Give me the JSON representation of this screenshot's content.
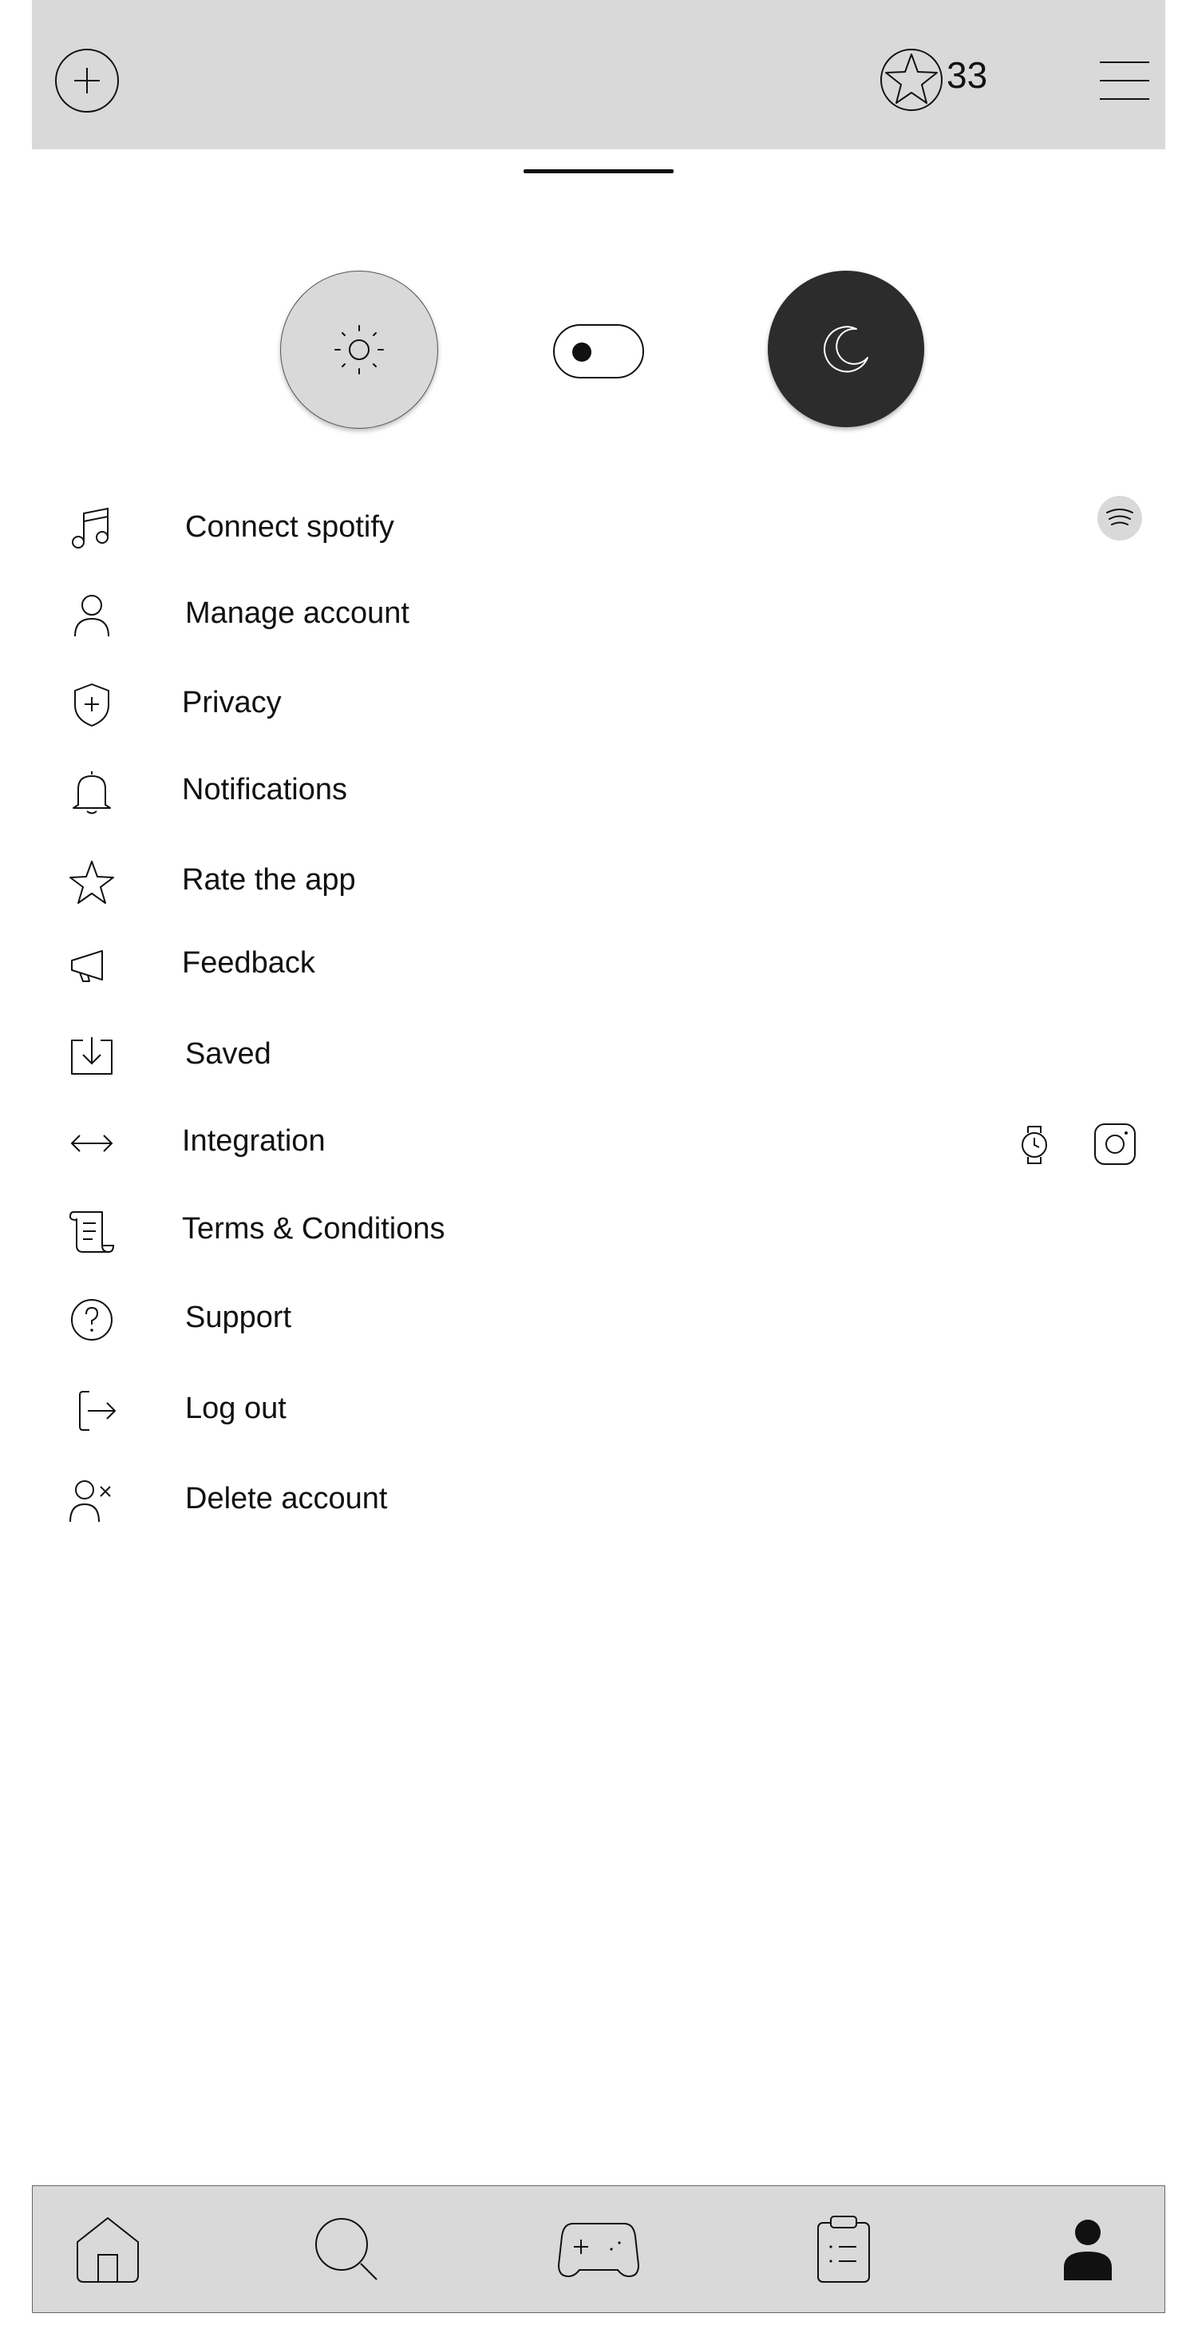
{
  "header": {
    "add_icon": "plus-circle-icon",
    "stars_icon": "star-badge-icon",
    "stars_count": "33",
    "menu_icon": "hamburger-menu-icon"
  },
  "theme": {
    "light_icon": "sun-icon",
    "dark_icon": "moon-icon",
    "toggle_state": "light"
  },
  "settings": {
    "items": [
      {
        "label": "Connect spotify",
        "icon": "music-note-icon",
        "accessory": [
          "spotify-icon"
        ]
      },
      {
        "label": "Manage account",
        "icon": "user-icon"
      },
      {
        "label": "Privacy",
        "icon": "shield-icon"
      },
      {
        "label": "Notifications",
        "icon": "bell-icon"
      },
      {
        "label": "Rate the app",
        "icon": "star-icon"
      },
      {
        "label": "Feedback",
        "icon": "megaphone-icon"
      },
      {
        "label": "Saved",
        "icon": "download-tray-icon"
      },
      {
        "label": "Integration",
        "icon": "arrows-horizontal-icon",
        "accessory": [
          "watch-icon",
          "instagram-icon"
        ]
      },
      {
        "label": "Terms & Conditions",
        "icon": "scroll-icon"
      },
      {
        "label": "Support",
        "icon": "question-circle-icon"
      },
      {
        "label": "Log out",
        "icon": "logout-icon"
      },
      {
        "label": "Delete account",
        "icon": "user-remove-icon"
      }
    ]
  },
  "bottom_nav": {
    "items": [
      {
        "icon": "home-icon"
      },
      {
        "icon": "search-icon"
      },
      {
        "icon": "gamepad-icon"
      },
      {
        "icon": "clipboard-icon"
      },
      {
        "icon": "profile-icon",
        "active": true
      }
    ]
  },
  "colors": {
    "bar_background": "#d9d9d9",
    "dark_button": "#2c2c2c",
    "text": "#111111"
  }
}
